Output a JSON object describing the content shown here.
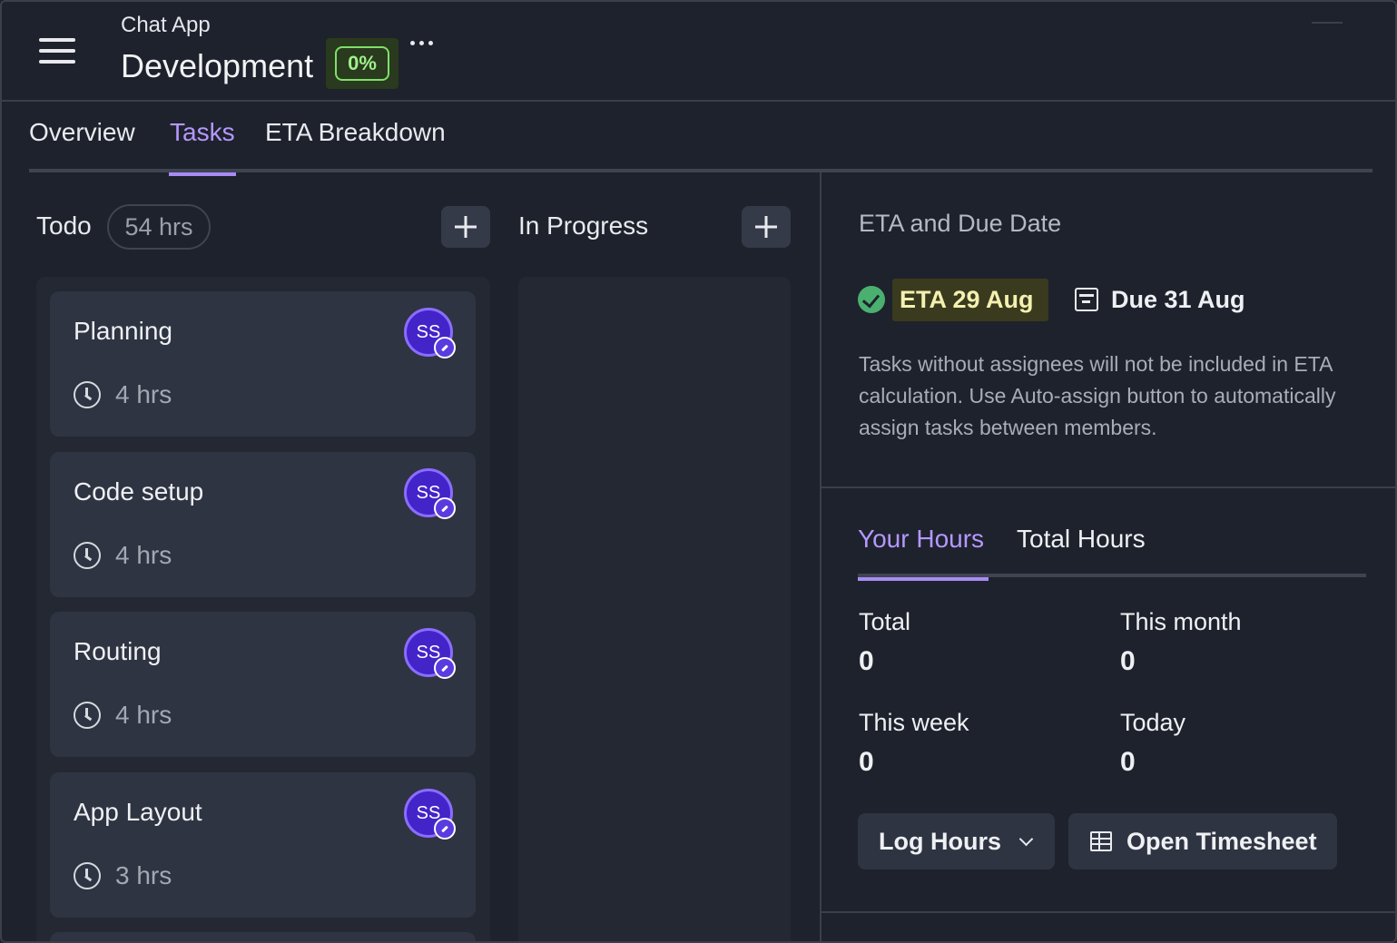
{
  "header": {
    "app_name": "Chat App",
    "project_title": "Development",
    "progress": "0%"
  },
  "tabs": [
    {
      "label": "Overview",
      "active": false
    },
    {
      "label": "Tasks",
      "active": true
    },
    {
      "label": "ETA Breakdown",
      "active": false
    }
  ],
  "board": {
    "todo": {
      "title": "Todo",
      "hours": "54 hrs",
      "cards": [
        {
          "title": "Planning",
          "hours": "4 hrs",
          "assignee": "SS"
        },
        {
          "title": "Code setup",
          "hours": "4 hrs",
          "assignee": "SS"
        },
        {
          "title": "Routing",
          "hours": "4 hrs",
          "assignee": "SS"
        },
        {
          "title": "App Layout",
          "hours": "3 hrs",
          "assignee": "SS"
        }
      ]
    },
    "in_progress": {
      "title": "In Progress"
    }
  },
  "eta": {
    "title": "ETA and Due Date",
    "eta_label": "ETA 29 Aug",
    "due_label": "Due 31 Aug",
    "note": "Tasks without assignees will not be included in ETA calculation. Use Auto-assign button to automatically assign tasks between members."
  },
  "hours": {
    "tabs": [
      {
        "label": "Your Hours",
        "active": true
      },
      {
        "label": "Total Hours",
        "active": false
      }
    ],
    "stats": {
      "total_label": "Total",
      "total_value": "0",
      "month_label": "This month",
      "month_value": "0",
      "week_label": "This week",
      "week_value": "0",
      "today_label": "Today",
      "today_value": "0"
    },
    "log_hours_label": "Log Hours",
    "open_timesheet_label": "Open Timesheet"
  },
  "colors": {
    "background": "#1e222c",
    "accent": "#a88bf5",
    "progress_green": "#7ee06a",
    "eta_check": "#4ab070",
    "avatar": "#4324c9"
  }
}
